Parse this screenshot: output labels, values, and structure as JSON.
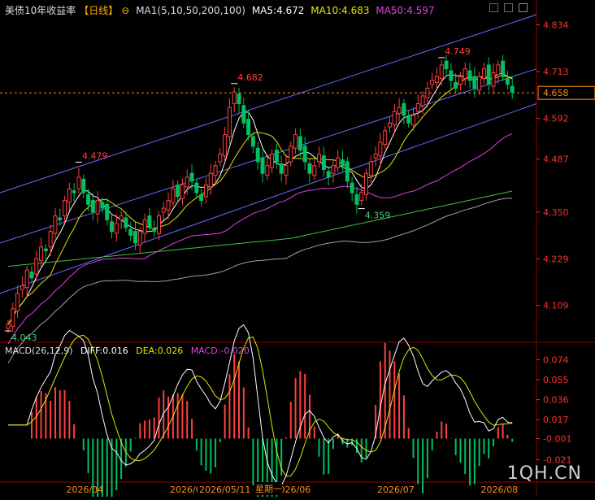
{
  "header": {
    "symbol": "美债10年收益率",
    "period": "【日线】",
    "ma_params": "MA1(5,10,50,200,100)",
    "ma5_label": "MA5:4.672",
    "ma10_label": "MA10:4.683",
    "ma50_label": "MA50:4.597"
  },
  "macd": {
    "params": "MACD(26,12,9)",
    "diff_label": "DIFF:0.016",
    "dea_label": "DEA:0.026",
    "macd_label": "MACD:-0.020"
  },
  "cursor": {
    "date": "2026/05/11",
    "weekday": "星期一"
  },
  "watermark": "1QH.CN",
  "colors": {
    "up": "#ff4040",
    "down": "#00c060",
    "ma5": "#ffffff",
    "ma10": "#e6e600",
    "ma50": "#e040e0",
    "ma100": "#a0a0a0",
    "ma200": "#40c040",
    "channel": "#6a6aff",
    "axis": "#ff3030"
  },
  "chart_data": [
    {
      "type": "candlestick",
      "y_ticks": [
        "4.834",
        "4.713",
        "4.592",
        "4.487",
        "4.350",
        "4.229",
        "4.109"
      ],
      "y_tick_values": [
        4.834,
        4.713,
        4.592,
        4.487,
        4.35,
        4.229,
        4.109
      ],
      "current_price": "4.658",
      "ylim": [
        4.02,
        4.86
      ],
      "x_ticks": [
        "2026/04",
        "2026/05",
        "2026/06",
        "2026/07",
        "2026/08"
      ],
      "annotations": [
        {
          "label": "4.043",
          "date_index": 0,
          "value": 4.043,
          "kind": "low"
        },
        {
          "label": "4.479",
          "date_index": 15,
          "value": 4.479,
          "kind": "high"
        },
        {
          "label": "4.682",
          "date_index": 48,
          "value": 4.682,
          "kind": "high"
        },
        {
          "label": "4.359",
          "date_index": 75,
          "value": 4.359,
          "kind": "low"
        },
        {
          "label": "4.749",
          "date_index": 92,
          "value": 4.749,
          "kind": "high"
        }
      ],
      "closes": [
        4.06,
        4.1,
        4.14,
        4.16,
        4.2,
        4.18,
        4.23,
        4.26,
        4.25,
        4.3,
        4.34,
        4.33,
        4.38,
        4.41,
        4.4,
        4.44,
        4.4,
        4.37,
        4.35,
        4.38,
        4.36,
        4.33,
        4.3,
        4.32,
        4.34,
        4.31,
        4.29,
        4.27,
        4.3,
        4.33,
        4.31,
        4.3,
        4.34,
        4.36,
        4.38,
        4.41,
        4.39,
        4.42,
        4.44,
        4.43,
        4.4,
        4.38,
        4.42,
        4.45,
        4.47,
        4.5,
        4.55,
        4.62,
        4.66,
        4.63,
        4.58,
        4.55,
        4.52,
        4.48,
        4.45,
        4.47,
        4.5,
        4.48,
        4.45,
        4.47,
        4.52,
        4.55,
        4.51,
        4.48,
        4.45,
        4.47,
        4.5,
        4.46,
        4.44,
        4.47,
        4.49,
        4.47,
        4.43,
        4.4,
        4.37,
        4.4,
        4.45,
        4.48,
        4.5,
        4.53,
        4.56,
        4.58,
        4.61,
        4.62,
        4.6,
        4.58,
        4.6,
        4.63,
        4.65,
        4.67,
        4.69,
        4.7,
        4.73,
        4.72,
        4.69,
        4.67,
        4.7,
        4.72,
        4.69,
        4.67,
        4.7,
        4.72,
        4.68,
        4.71,
        4.73,
        4.7,
        4.68,
        4.66
      ],
      "ma_series": [
        {
          "name": "MA5",
          "last": 4.672
        },
        {
          "name": "MA10",
          "last": 4.683
        },
        {
          "name": "MA50",
          "last": 4.597
        }
      ]
    },
    {
      "type": "macd",
      "y_ticks": [
        "0.074",
        "0.055",
        "0.036",
        "0.017",
        "-0.001",
        "-0.021"
      ],
      "y_tick_values": [
        0.074,
        0.055,
        0.036,
        0.017,
        -0.001,
        -0.021
      ],
      "ylim": [
        -0.04,
        0.082
      ],
      "diff": 0.016,
      "dea": 0.026,
      "macd": -0.02
    }
  ]
}
